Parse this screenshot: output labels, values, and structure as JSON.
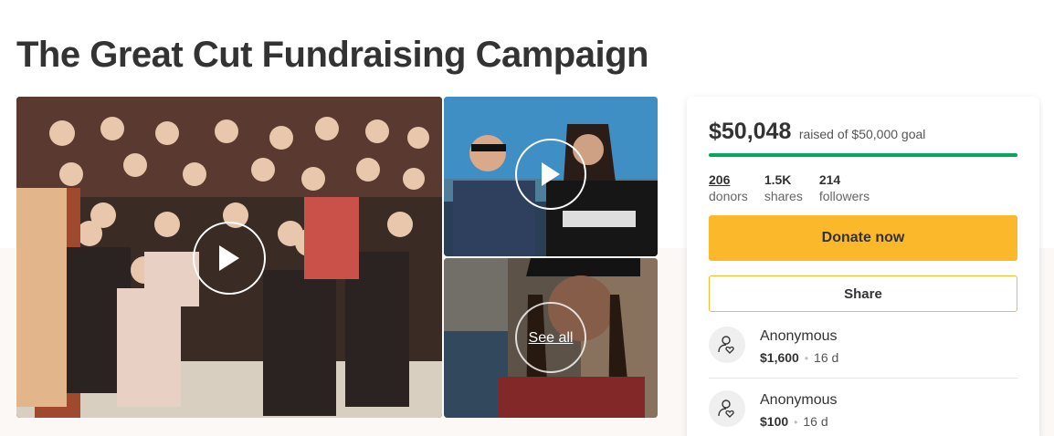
{
  "campaign": {
    "title": "The Great Cut Fundraising Campaign"
  },
  "media": {
    "see_all_label": "See all"
  },
  "progress": {
    "raised": "$50,048",
    "goal_text": "raised of $50,000 goal",
    "fraction": 1.0,
    "bar_color": "#02a95c"
  },
  "stats": [
    {
      "value": "206",
      "label": "donors"
    },
    {
      "value": "1.5K",
      "label": "shares"
    },
    {
      "value": "214",
      "label": "followers"
    }
  ],
  "actions": {
    "donate_label": "Donate now",
    "share_label": "Share",
    "donate_color": "#fbb82b"
  },
  "donations": [
    {
      "name": "Anonymous",
      "amount": "$1,600",
      "time": "16 d",
      "icon": "donor-heart-icon"
    },
    {
      "name": "Anonymous",
      "amount": "$100",
      "time": "16 d",
      "icon": "donor-heart-icon"
    }
  ]
}
